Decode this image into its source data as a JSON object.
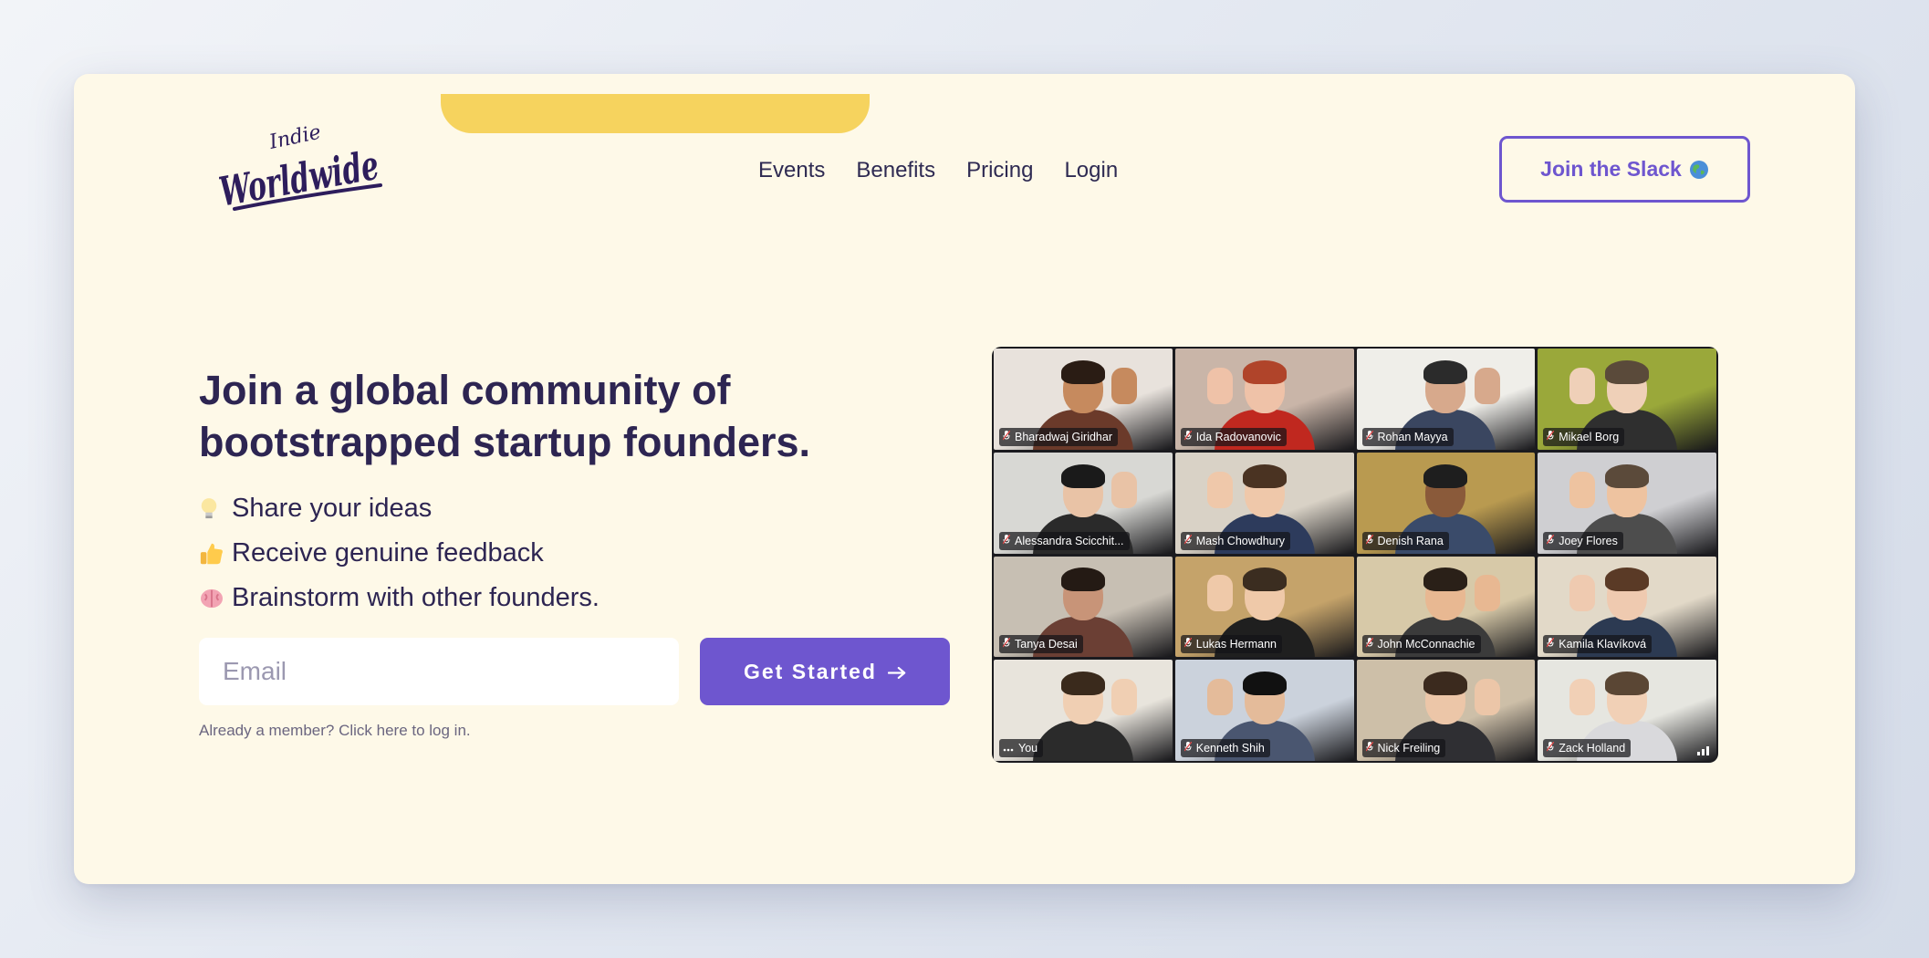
{
  "brand": {
    "logo_word_small": "Indie",
    "logo_word_main": "Worldwide",
    "accent": "#6e56cf",
    "dark": "#2d2552",
    "cream": "#fef9e8",
    "yellow": "#f6d35e"
  },
  "nav": {
    "items": [
      {
        "label": "Events"
      },
      {
        "label": "Benefits"
      },
      {
        "label": "Pricing"
      },
      {
        "label": "Login"
      }
    ],
    "cta_label": "Join the Slack",
    "cta_icon": "globe-icon"
  },
  "hero": {
    "headline_line1": "Join a global community of",
    "headline_line2": "bootstrapped startup founders.",
    "bullets": [
      {
        "icon": "lightbulb-icon",
        "text": "Share your ideas"
      },
      {
        "icon": "thumbs-up-icon",
        "text": "Receive genuine feedback"
      },
      {
        "icon": "brain-icon",
        "text": "Brainstorm with other founders."
      }
    ],
    "email_placeholder": "Email",
    "email_value": "",
    "cta_label": "Get Started",
    "cta_icon": "arrow-right-icon",
    "login_hint": "Already a member? Click here to log in."
  },
  "video_call": {
    "participants": [
      {
        "name": "Bharadwaj Giridhar",
        "icon": "muted-mic-icon"
      },
      {
        "name": "Ida Radovanovic",
        "icon": "muted-mic-icon"
      },
      {
        "name": "Rohan Mayya",
        "icon": "muted-mic-icon"
      },
      {
        "name": "Mikael Borg",
        "icon": "muted-mic-icon"
      },
      {
        "name": "Alessandra Scicchit...",
        "icon": "muted-mic-icon"
      },
      {
        "name": "Mash Chowdhury",
        "icon": "muted-mic-icon"
      },
      {
        "name": "Denish Rana",
        "icon": "muted-mic-icon"
      },
      {
        "name": "Joey Flores",
        "icon": "muted-mic-icon"
      },
      {
        "name": "Tanya Desai",
        "icon": "muted-mic-icon"
      },
      {
        "name": "Lukas Hermann",
        "icon": "muted-mic-icon"
      },
      {
        "name": "John McConnachie",
        "icon": "muted-mic-icon"
      },
      {
        "name": "Kamila Klavíková",
        "icon": "muted-mic-icon"
      },
      {
        "name": "You",
        "icon": "more-dots-icon"
      },
      {
        "name": "Kenneth Shih",
        "icon": "muted-mic-icon"
      },
      {
        "name": "Nick Freiling",
        "icon": "muted-mic-icon"
      },
      {
        "name": "Zack Holland",
        "icon": "muted-mic-icon"
      }
    ]
  }
}
